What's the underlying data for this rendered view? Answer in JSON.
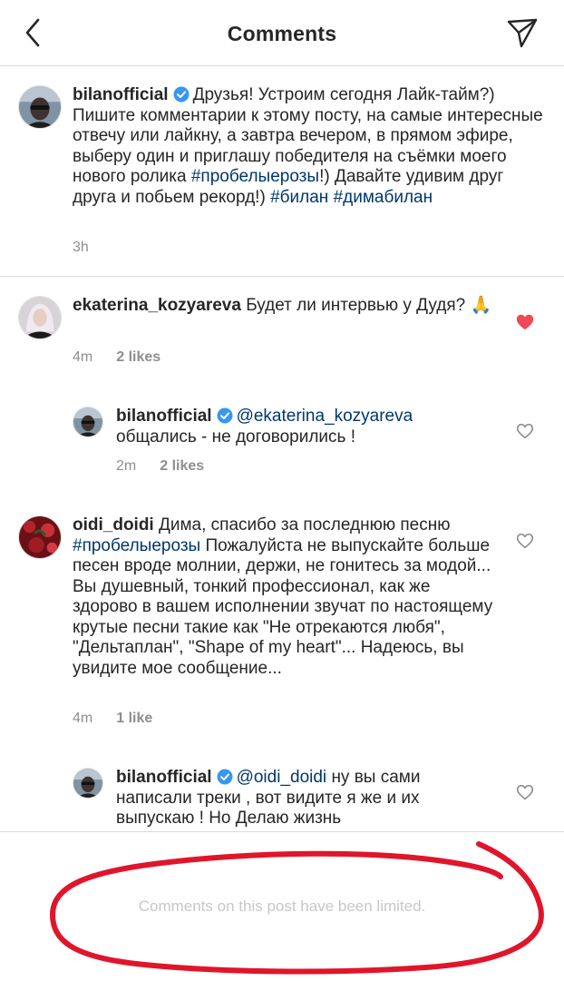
{
  "header": {
    "title": "Comments"
  },
  "post": {
    "username": "bilanofficial",
    "text_before_tag": "Друзья! Устроим сегодня Лайк-тайм?) Пишите комментарии к этому посту, на самые интересные отвечу или лайкну, а завтра вечером, в прямом эфире, выберу один и приглашу победителя на съёмки моего нового ролика",
    "hashtag1": "#пробелыерозы",
    "text_after_tag": "!) Давайте удивим друг друга и побьем рекорд!)",
    "hashtag2": "#билан",
    "hashtag3": "#димабилан",
    "time": "3h"
  },
  "comments": [
    {
      "username": "ekaterina_kozyareva",
      "text": "Будет ли интервью у Дудя? 🙏",
      "time": "4m",
      "likes": "2 likes",
      "liked": true,
      "reply": {
        "username": "bilanofficial",
        "mention": "@ekaterina_kozyareva",
        "text": "общались - не договорились !",
        "time": "2m",
        "likes": "2 likes"
      }
    },
    {
      "username": "oidi_doidi",
      "text_before_tag": "Дима, спасибо за последнюю песню",
      "hashtag": "#пробелыерозы",
      "text_after_tag": "Пожалуйста не выпускайте больше песен вроде молнии, держи, не гонитесь за модой... Вы душевный, тонкий профессионал, как же здорово в вашем исполнении звучат по настоящему крутые песни такие как \"Не отрекаются любя\", \"Дельтаплан\", \"Shape of my heart\"... Надеюсь, вы увидите мое сообщение...",
      "time": "4m",
      "likes": "1 like",
      "liked": false,
      "reply": {
        "username": "bilanofficial",
        "mention": "@oidi_doidi",
        "text": "ну вы сами написали треки , вот видите я же и их выпускаю ! Но Делаю жизнь"
      }
    }
  ],
  "footer": {
    "limited_text": "Comments on this post have been limited."
  },
  "colors": {
    "link": "#00376b",
    "heart_liked": "#ed4956",
    "verified": "#3897f0",
    "scribble": "#e0152b"
  }
}
